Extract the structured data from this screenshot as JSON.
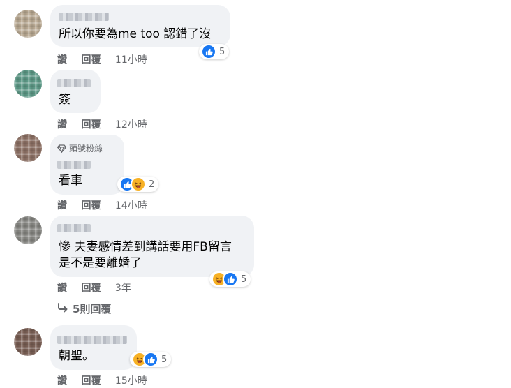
{
  "comments": [
    {
      "text": "所以你要為me too 認錯了沒",
      "actions": {
        "like": "讚",
        "reply": "回覆",
        "time": "11小時"
      },
      "reaction_count": "5"
    },
    {
      "text": "簽",
      "actions": {
        "like": "讚",
        "reply": "回覆",
        "time": "12小時"
      }
    },
    {
      "badge": "頭號粉絲",
      "text": "看車",
      "actions": {
        "like": "讚",
        "reply": "回覆",
        "time": "14小時"
      },
      "reaction_count": "2"
    },
    {
      "text_line1": "慘 夫妻感情差到講話要用FB留言",
      "text_line2": "是不是要離婚了",
      "actions": {
        "like": "讚",
        "reply": "回覆",
        "time": "3年"
      },
      "reaction_count": "5",
      "replies_label": "5則回覆"
    },
    {
      "text": "朝聖。",
      "actions": {
        "like": "讚",
        "reply": "回覆",
        "time": "15小時"
      },
      "reaction_count": "5"
    }
  ],
  "colors": {
    "bubble": "#f0f2f5",
    "secondary_text": "#65676b",
    "like_blue": "#1877f2",
    "haha_yellow": "#f7b125"
  },
  "icons": [
    "like-reaction-icon",
    "haha-reaction-icon",
    "diamond-icon",
    "reply-arrow-icon"
  ]
}
